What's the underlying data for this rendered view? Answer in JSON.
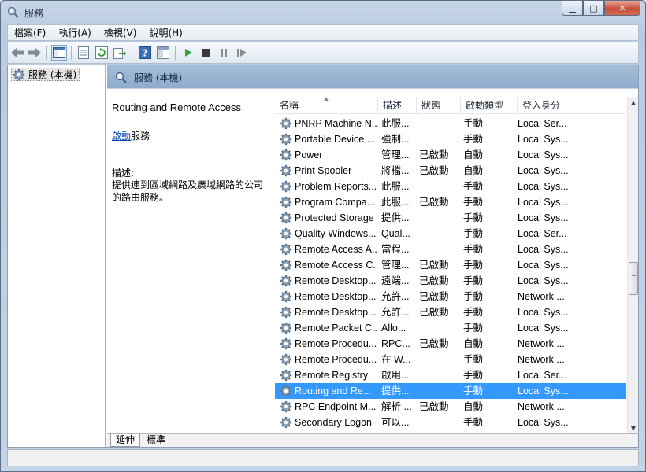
{
  "window": {
    "title": "服務"
  },
  "menu": {
    "items": [
      "檔案(F)",
      "執行(A)",
      "檢視(V)",
      "說明(H)"
    ]
  },
  "tree": {
    "root_label": "服務 (本機)"
  },
  "pane": {
    "header_label": "服務 (本機)"
  },
  "detail": {
    "service_name": "Routing and Remote Access",
    "start_link": "啟動",
    "start_suffix": "服務",
    "desc_label": "描述:",
    "desc_text": "提供連到區域網路及廣域網路的公司的路由服務。"
  },
  "list": {
    "columns": [
      "名稱",
      "描述",
      "狀態",
      "啟動類型",
      "登入身分"
    ],
    "rows": [
      {
        "name": "PNRP Machine N...",
        "desc": "此服...",
        "status": "",
        "startup": "手動",
        "logon": "Local Ser..."
      },
      {
        "name": "Portable Device ...",
        "desc": "強制...",
        "status": "",
        "startup": "手動",
        "logon": "Local Sys..."
      },
      {
        "name": "Power",
        "desc": "管理...",
        "status": "已啟動",
        "startup": "自動",
        "logon": "Local Sys..."
      },
      {
        "name": "Print Spooler",
        "desc": "將檔...",
        "status": "已啟動",
        "startup": "自動",
        "logon": "Local Sys..."
      },
      {
        "name": "Problem Reports...",
        "desc": "此服...",
        "status": "",
        "startup": "手動",
        "logon": "Local Sys..."
      },
      {
        "name": "Program Compa...",
        "desc": "此服...",
        "status": "已啟動",
        "startup": "手動",
        "logon": "Local Sys..."
      },
      {
        "name": "Protected Storage",
        "desc": "提供...",
        "status": "",
        "startup": "手動",
        "logon": "Local Sys..."
      },
      {
        "name": "Quality Windows...",
        "desc": "Qual...",
        "status": "",
        "startup": "手動",
        "logon": "Local Ser..."
      },
      {
        "name": "Remote Access A...",
        "desc": "當程...",
        "status": "",
        "startup": "手動",
        "logon": "Local Sys..."
      },
      {
        "name": "Remote Access C...",
        "desc": "管理...",
        "status": "已啟動",
        "startup": "手動",
        "logon": "Local Sys..."
      },
      {
        "name": "Remote Desktop...",
        "desc": "遠端...",
        "status": "已啟動",
        "startup": "手動",
        "logon": "Local Sys..."
      },
      {
        "name": "Remote Desktop...",
        "desc": "允許...",
        "status": "已啟動",
        "startup": "手動",
        "logon": "Network ..."
      },
      {
        "name": "Remote Desktop...",
        "desc": "允許...",
        "status": "已啟動",
        "startup": "手動",
        "logon": "Local Sys..."
      },
      {
        "name": "Remote Packet C...",
        "desc": "Allo...",
        "status": "",
        "startup": "手動",
        "logon": "Local Sys..."
      },
      {
        "name": "Remote Procedu...",
        "desc": "RPC...",
        "status": "已啟動",
        "startup": "自動",
        "logon": "Network ..."
      },
      {
        "name": "Remote Procedu...",
        "desc": "在 W...",
        "status": "",
        "startup": "手動",
        "logon": "Network ..."
      },
      {
        "name": "Remote Registry",
        "desc": "啟用...",
        "status": "",
        "startup": "手動",
        "logon": "Local Ser..."
      },
      {
        "name": "Routing and Re...",
        "desc": "提供...",
        "status": "",
        "startup": "手動",
        "logon": "Local Sys...",
        "selected": true
      },
      {
        "name": "RPC Endpoint M...",
        "desc": "解析 ...",
        "status": "已啟動",
        "startup": "自動",
        "logon": "Network ..."
      },
      {
        "name": "Secondary Logon",
        "desc": "可以...",
        "status": "",
        "startup": "手動",
        "logon": "Local Sys..."
      }
    ]
  },
  "tabs": {
    "extended": "延伸",
    "standard": "標準"
  },
  "colors": {
    "selection": "#3399ff",
    "header_bg": "#a3bdd8",
    "link": "#0645ad"
  }
}
